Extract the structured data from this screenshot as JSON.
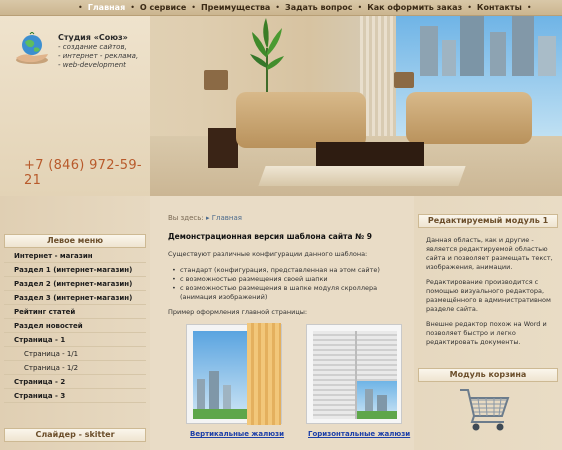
{
  "nav": {
    "items": [
      "Главная",
      "О сервисе",
      "Преимущества",
      "Задать вопрос",
      "Как оформить заказ",
      "Контакты"
    ]
  },
  "brand": {
    "title": "Студия «Союз»",
    "lines": [
      "- создание сайтов,",
      "- интернет - реклама,",
      "- web-development"
    ],
    "phone": "+7 (846) 972-59-21"
  },
  "breadcrumb": {
    "prefix": "Вы здесь:",
    "current": "Главная"
  },
  "left_menu": {
    "title": "Левое меню",
    "items": [
      "Интернет - магазин",
      "Раздел 1 (интернет-магазин)",
      "Раздел 2 (интернет-магазин)",
      "Раздел 3 (интернет-магазин)",
      "Рейтинг статей",
      "Раздел новостей",
      "Страница - 1",
      "Страница - 1/1",
      "Страница - 1/2",
      "Страница - 2",
      "Страница - 3"
    ],
    "slider_title": "Слайдер - skitter"
  },
  "main": {
    "title": "Демонстрационная версия шаблона сайта № 9",
    "intro": "Существуют различные конфигурации данного шаблона:",
    "bullets": [
      "стандарт (конфигурация, представленная на этом сайте)",
      "с возможностью размещения своей шапки",
      "с возможностью размещения в шапке модуля скроллера",
      "(анимация изображений)"
    ],
    "example_label": "Пример оформления главной страницы:",
    "link1": "Вертикальные жалюзи",
    "link2": "Горизонтальные жалюзи"
  },
  "right": {
    "module1_title": "Редактируемый модуль 1",
    "para1": [
      "Данная область, как и другие -",
      "является редактируемой областью",
      "сайта и позволяет размещать текст,",
      "изображения, анимации."
    ],
    "para2": [
      "Редактирование производится с",
      "помощью визуального редактора,",
      "размещённого в административном",
      "разделе сайта."
    ],
    "para3": [
      "Внешне редактор похож на Word и",
      "позволяет быстро и легко",
      "редактировать документы."
    ],
    "module2_title": "Модуль корзина"
  },
  "icons": {
    "logo": "globe-hand-logo-icon",
    "cart": "shopping-cart-icon"
  },
  "colors": {
    "accent": "#b85a2b",
    "link": "#1c3fa8",
    "nav_bg": "#cbb58f"
  }
}
